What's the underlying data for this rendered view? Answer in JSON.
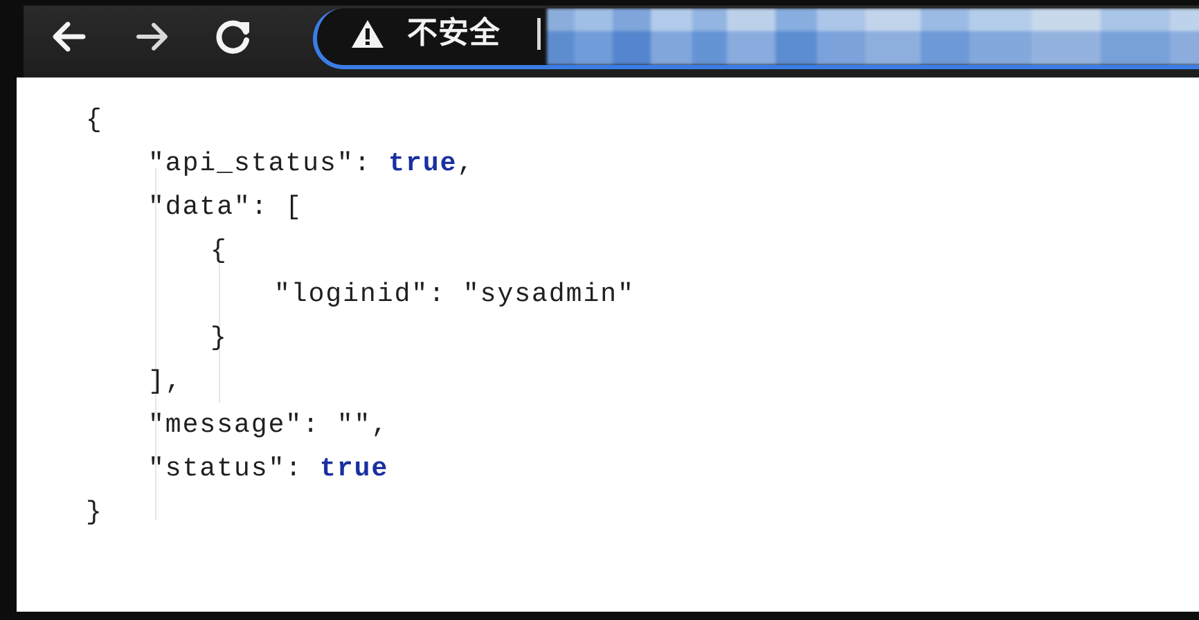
{
  "browser": {
    "nav": {
      "back_icon": "arrow-left-icon",
      "forward_icon": "arrow-right-icon",
      "reload_icon": "reload-icon"
    },
    "omnibox": {
      "security_icon": "warning-triangle-icon",
      "security_label": "不安全",
      "accent_color": "#3b7de6"
    }
  },
  "json_view": {
    "lines": [
      "{",
      "\"api_status\": ",
      "true",
      ",",
      "\"data\": [",
      "{",
      "\"loginid\": \"sysadmin\"",
      "}",
      "],",
      "\"message\": \"\",",
      "\"status\": ",
      "true",
      "}"
    ],
    "keyword_color": "#1a2fa0"
  }
}
